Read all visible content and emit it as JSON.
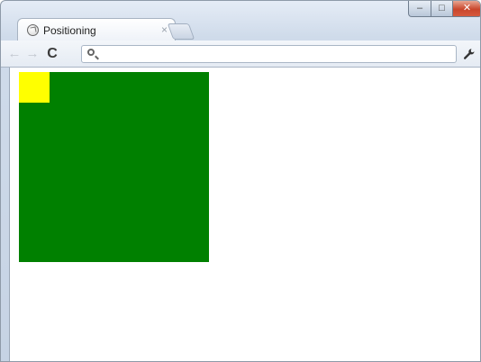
{
  "browser": {
    "tab": {
      "title": "Positioning",
      "close_glyph": "×",
      "favicon": "globe-icon"
    },
    "window_controls": {
      "minimize_glyph": "–",
      "maximize_glyph": "□",
      "close_glyph": "✕"
    },
    "toolbar": {
      "back_glyph": "←",
      "forward_glyph": "→",
      "reload_glyph": "C",
      "search_icon": "search-icon",
      "omnibox_value": "",
      "omnibox_placeholder": "",
      "wrench_glyph": "🔧"
    }
  },
  "page": {
    "colors": {
      "outer_box": "#008000",
      "inner_box": "#ffff00",
      "background": "#ffffff"
    }
  }
}
